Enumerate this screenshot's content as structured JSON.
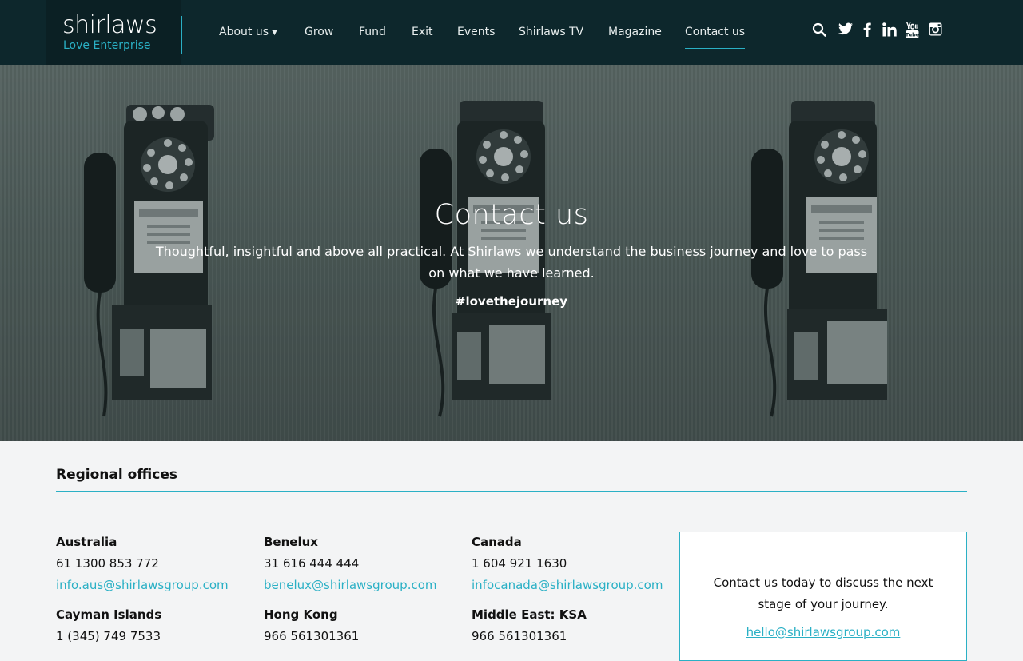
{
  "header": {
    "logo_main": "shirlaws",
    "logo_sub": "Love Enterprise",
    "nav": [
      {
        "label": "About us",
        "has_dropdown": true
      },
      {
        "label": "Grow"
      },
      {
        "label": "Fund"
      },
      {
        "label": "Exit"
      },
      {
        "label": "Events"
      },
      {
        "label": "Shirlaws TV"
      },
      {
        "label": "Magazine"
      },
      {
        "label": "Contact us",
        "active": true
      }
    ],
    "social_icons": [
      "search-icon",
      "twitter-icon",
      "facebook-icon",
      "linkedin-icon",
      "youtube-icon",
      "instagram-icon"
    ]
  },
  "hero": {
    "title": "Contact us",
    "text": "Thoughtful, insightful and above all practical. At Shirlaws we understand the business journey and love to pass on what we have learned.",
    "tag": "#lovethejourney"
  },
  "offices": {
    "title": "Regional offices",
    "items": [
      {
        "name": "Australia",
        "phone": "61 1300 853 772",
        "email": "info.aus@shirlawsgroup.com"
      },
      {
        "name": "Benelux",
        "phone": "31 616 444 444",
        "email": "benelux@shirlawsgroup.com"
      },
      {
        "name": "Canada",
        "phone": "1 604 921 1630",
        "email": "infocanada@shirlawsgroup.com"
      },
      {
        "name": "Cayman Islands",
        "phone": "1 (345) 749 7533",
        "email": ""
      },
      {
        "name": "Hong Kong",
        "phone": "966 561301361",
        "email": ""
      },
      {
        "name": "Middle East: KSA",
        "phone": "966 561301361",
        "email": ""
      }
    ]
  },
  "cta": {
    "text": "Contact us today to discuss the next stage of your journey.",
    "email": "hello@shirlawsgroup.com"
  },
  "colors": {
    "header_bg": "#0d272c",
    "accent": "#2ab0c5",
    "page_bg": "#f3f4f5"
  }
}
